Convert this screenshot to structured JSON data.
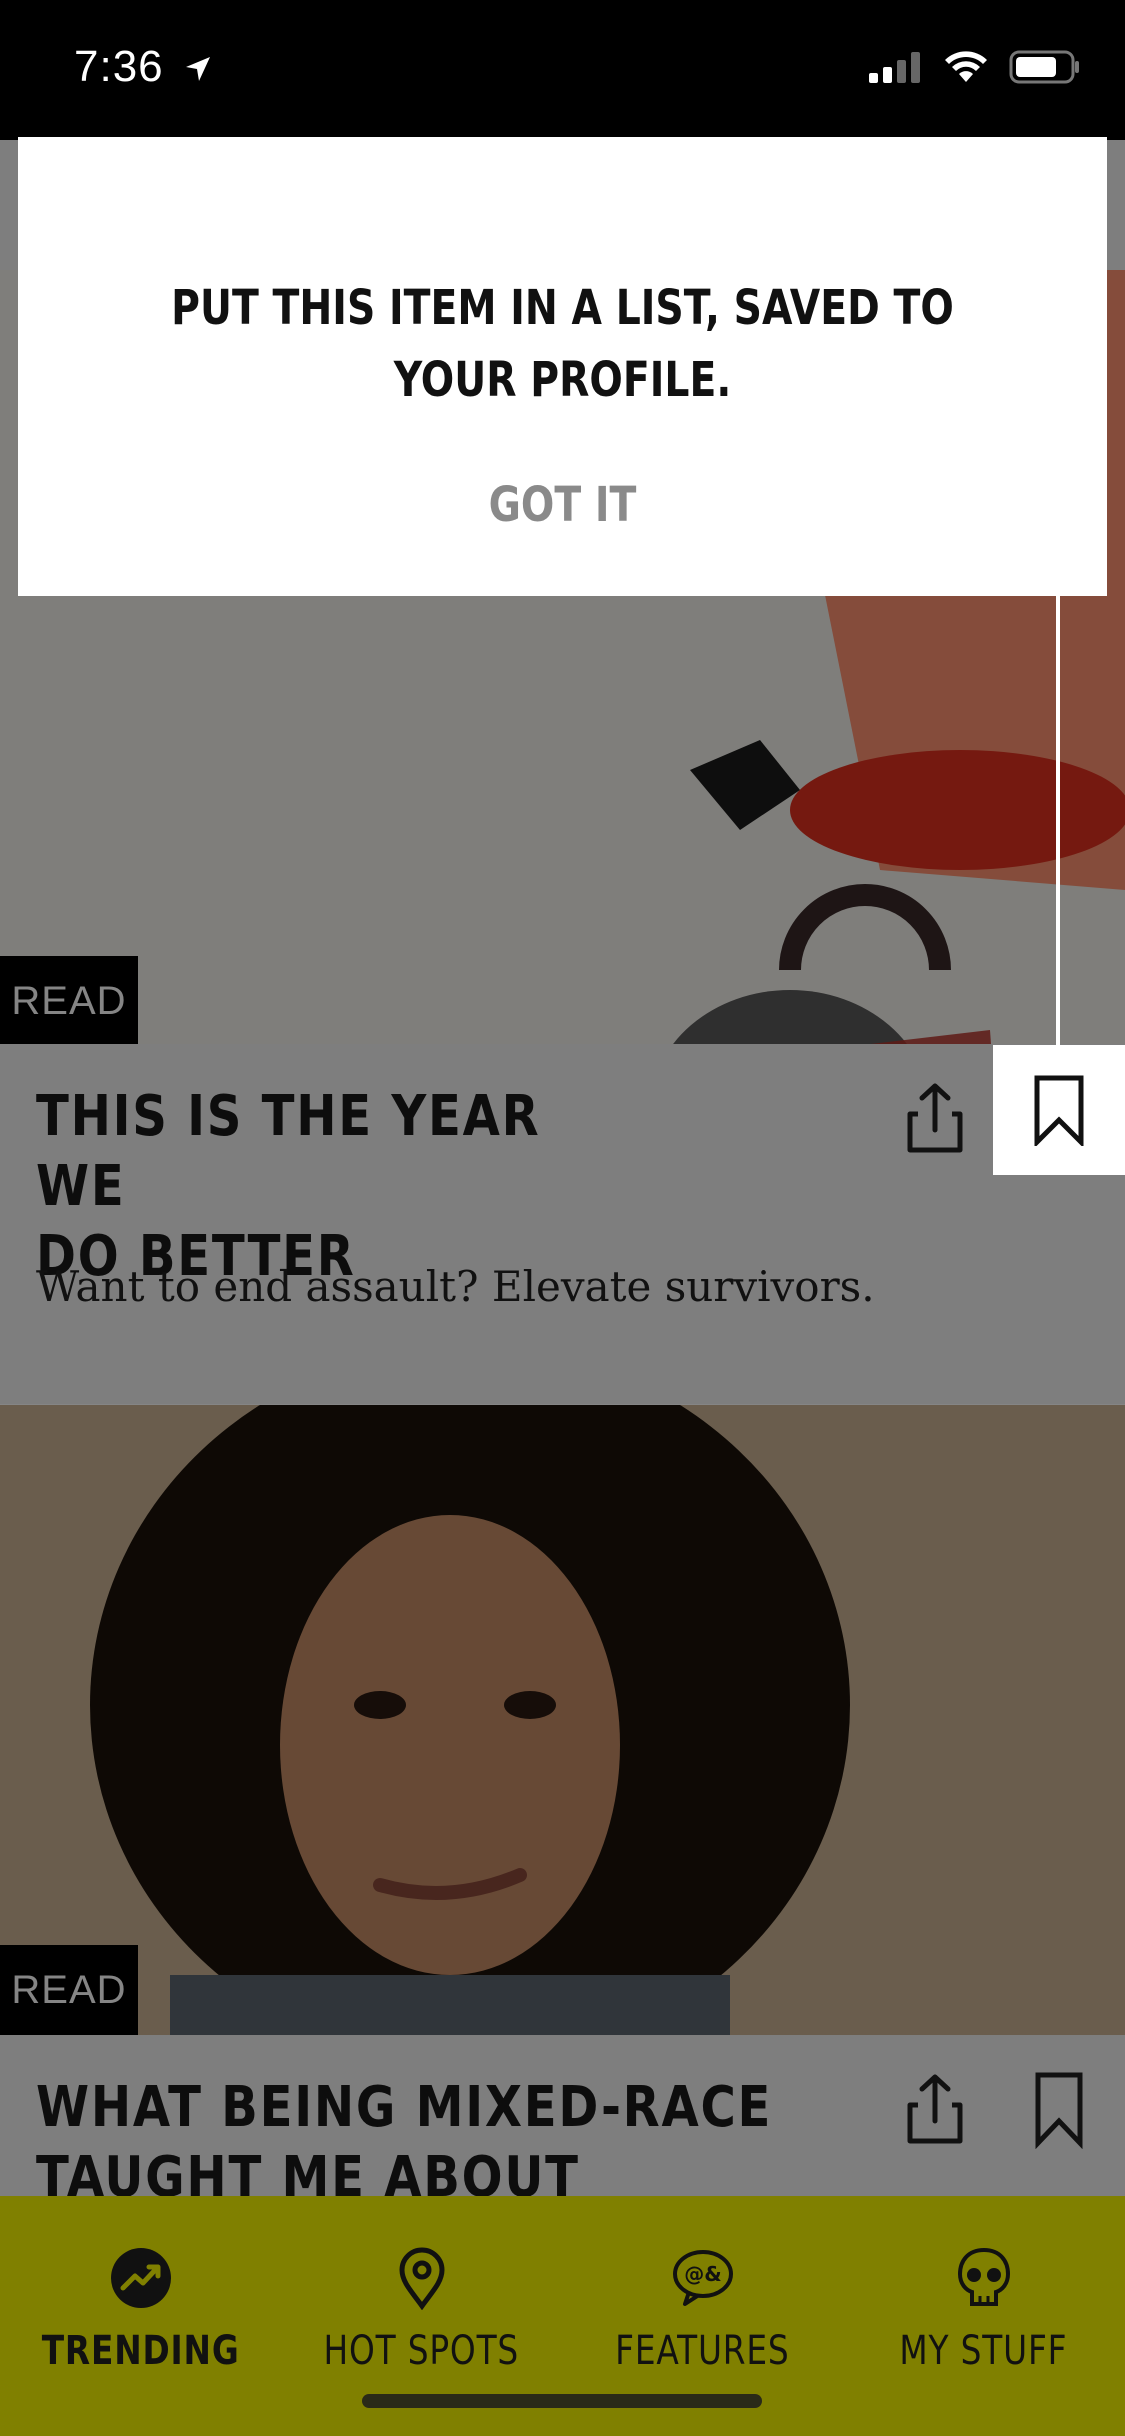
{
  "status": {
    "time": "7:36"
  },
  "tooltip": {
    "message_line1": "PUT THIS ITEM IN A LIST, SAVED TO",
    "message_line2": "YOUR PROFILE.",
    "button": "GOT IT"
  },
  "cards": [
    {
      "badge": "READ",
      "title_line1": "THIS IS THE YEAR WE",
      "title_line2": "DO BETTER",
      "subtitle": "Want to end assault? Elevate survivors."
    },
    {
      "badge": "READ",
      "title_line1": "WHAT BEING MIXED-RACE",
      "title_line2": "TAUGHT ME ABOUT CULTURAL"
    }
  ],
  "tabs": [
    {
      "label": "TRENDING",
      "icon": "trending-icon",
      "active": true
    },
    {
      "label": "HOT SPOTS",
      "icon": "map-pin-icon",
      "active": false
    },
    {
      "label": "FEATURES",
      "icon": "speech-bubble-icon",
      "active": false
    },
    {
      "label": "MY STUFF",
      "icon": "skull-icon",
      "active": false
    }
  ],
  "colors": {
    "tab_bar": "#808000",
    "accent_yellow": "#e8e000",
    "overlay": "rgba(0,0,0,0.48)"
  }
}
